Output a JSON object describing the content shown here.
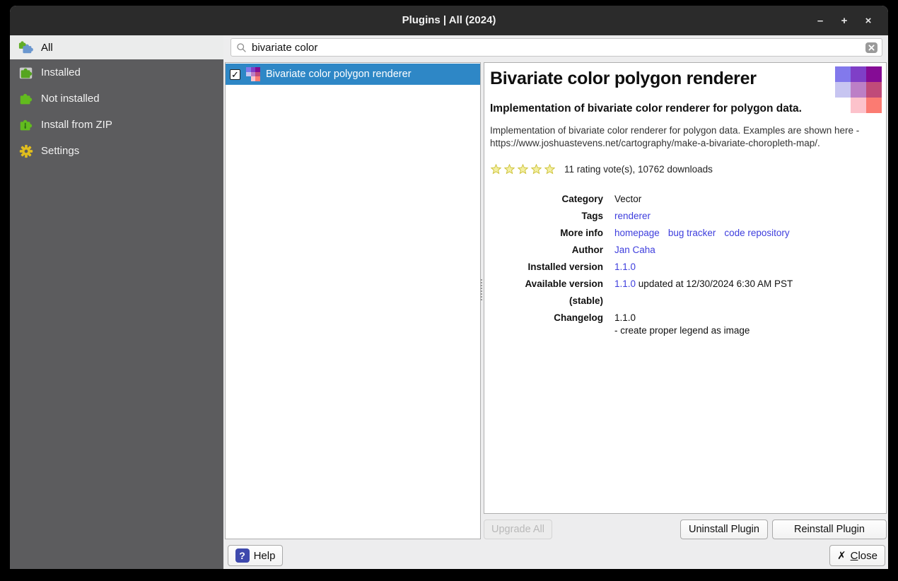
{
  "window": {
    "title": "Plugins | All (2024)",
    "controls": {
      "minimize": "–",
      "maximize": "+",
      "close": "×"
    }
  },
  "colors": {
    "selection_blue": "#2e87c6",
    "link_blue": "#3e3edd",
    "titlebar": "#2b2b2b",
    "sidebar_gray": "#5c5c5e",
    "star_fill": "#f3efa2",
    "star_stroke": "#c9bd2a"
  },
  "sidebar": {
    "items": [
      {
        "label": "All"
      },
      {
        "label": "Installed"
      },
      {
        "label": "Not installed"
      },
      {
        "label": "Install from ZIP"
      },
      {
        "label": "Settings"
      }
    ]
  },
  "search": {
    "value": "bivariate color"
  },
  "plugin_list": {
    "selected_item": {
      "label": "Bivariate color polygon renderer",
      "check": "✓"
    }
  },
  "details": {
    "title": "Bivariate color polygon renderer",
    "subtitle": "Implementation of bivariate color renderer for polygon data.",
    "description": "Implementation of bivariate color renderer for polygon data. Examples are shown here - https://www.joshuastevens.net/cartography/make-a-bivariate-choropleth-map/.",
    "rating_text": "11 rating vote(s), 10762 downloads",
    "meta": {
      "category_label": "Category",
      "category_value": "Vector",
      "tags_label": "Tags",
      "tags_link": "renderer",
      "moreinfo_label": "More info",
      "moreinfo_link1": "homepage",
      "moreinfo_link2": "bug tracker",
      "moreinfo_link3": "code repository",
      "author_label": "Author",
      "author_link": "Jan Caha",
      "installed_label": "Installed version",
      "installed_value": "1.1.0",
      "available_label": "Available version (stable)",
      "available_value": "1.1.0",
      "available_suffix": "updated at 12/30/2024 6:30 AM PST",
      "changelog_label": "Changelog",
      "changelog_line1": "1.1.0",
      "changelog_line2": "- create proper legend as image"
    },
    "icon_grid_colors": [
      "#8279ec",
      "#7f3fc7",
      "#850c95",
      "#c7c5f1",
      "#bc7fc6",
      "#c04b79",
      "transparent",
      "#fcc2cb",
      "#fb7b72"
    ]
  },
  "buttons": {
    "upgrade_all": "Upgrade All",
    "uninstall": "Uninstall Plugin",
    "reinstall": "Reinstall Plugin",
    "help": "Help",
    "help_icon": "?",
    "close_icon": "✗",
    "close_c": "C",
    "close_rest": "lose"
  }
}
